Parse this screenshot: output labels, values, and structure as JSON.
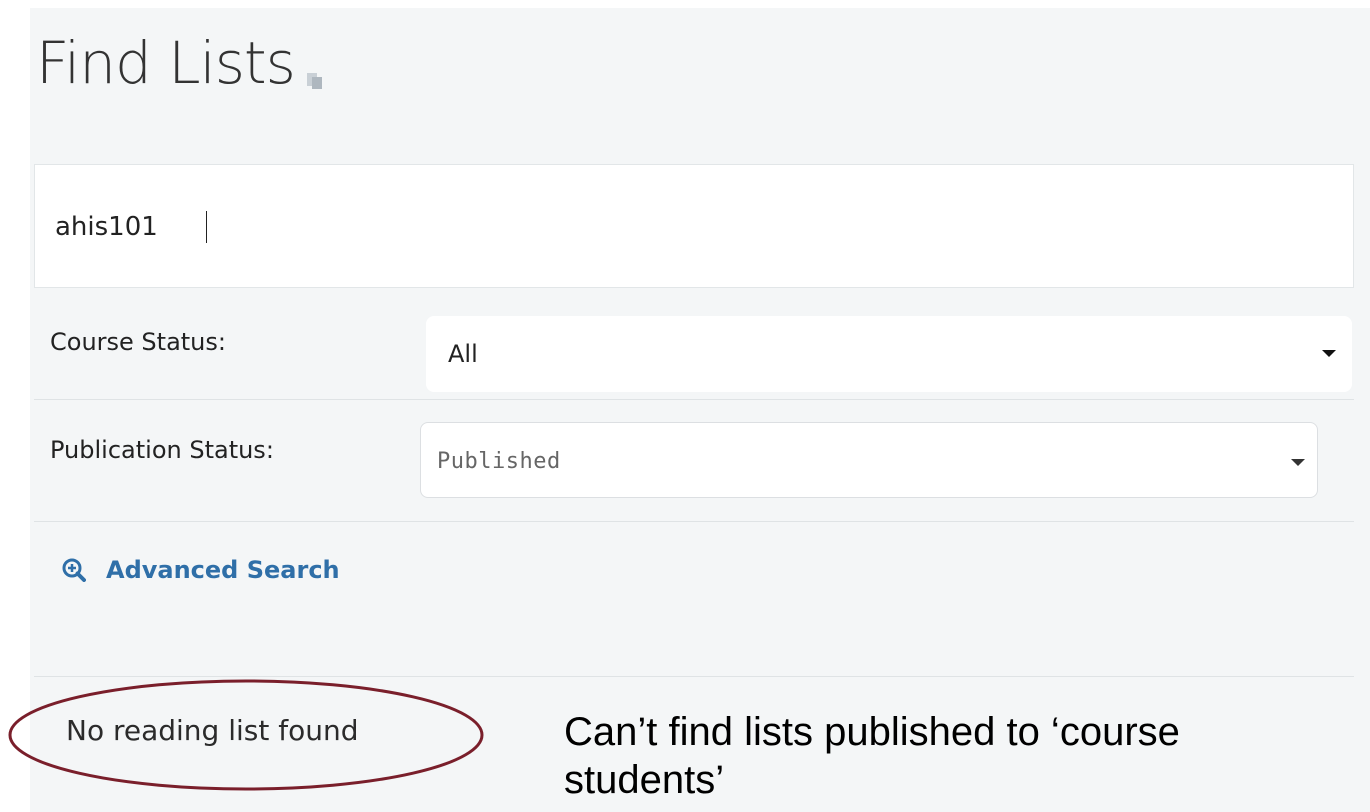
{
  "page": {
    "title": "Find Lists"
  },
  "search": {
    "value": "ahis101"
  },
  "filters": {
    "course_status": {
      "label": "Course Status:",
      "value": "All"
    },
    "publication_status": {
      "label": "Publication Status:",
      "value": "Published"
    }
  },
  "advanced_search": {
    "label": "Advanced Search"
  },
  "results": {
    "message": "No reading list found"
  },
  "annotation": {
    "text": "Can’t find lists published to ‘course students’"
  },
  "colors": {
    "panel_bg": "#f4f6f7",
    "link": "#2f6fa8",
    "highlight_ellipse": "#7a1f2b"
  },
  "icons": {
    "title_icon": "document-icon",
    "advanced_icon": "zoom-in-icon"
  }
}
